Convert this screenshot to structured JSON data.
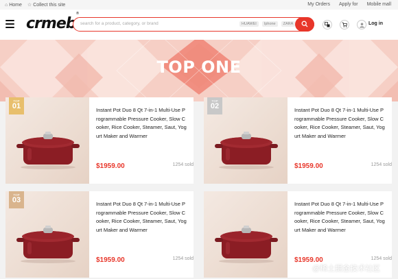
{
  "topbar": {
    "home_label": "Home",
    "collect_label": "Collect this site",
    "my_orders": "My Orders",
    "apply_for": "Apply for",
    "mobile_mall": "Mobile mall"
  },
  "header": {
    "logo_text": "crmeb",
    "logo_mark": "®",
    "search_placeholder": "search for a product, category, or brand",
    "search_tags": [
      "HUAWEI",
      "Iphone",
      "ZARA"
    ],
    "login_label": "Log in"
  },
  "banner": {
    "title": "TOP ONE"
  },
  "colors": {
    "accent": "#e8362a",
    "gold": "#e8bf6c",
    "silver": "#c8c8c8",
    "bronze": "#d9b48d"
  },
  "icons": [
    "home-icon",
    "star-icon",
    "menu-icon",
    "search-icon",
    "language-icon",
    "cart-icon",
    "avatar-icon"
  ],
  "products": [
    {
      "rank_label": "TOP",
      "rank": "01",
      "name": "Instant Pot Duo 8 Qt 7-in-1 Multi-Use Programmable Pressure Cooker, Slow Cooker, Rice Cooker, Steamer, Saut, Yogurt Maker and Warmer",
      "price": "$1959.00",
      "sold": "1254 sold"
    },
    {
      "rank_label": "TOP",
      "rank": "02",
      "name": "Instant Pot Duo 8 Qt 7-in-1 Multi-Use Programmable Pressure Cooker, Slow Cooker, Rice Cooker, Steamer, Saut, Yogurt Maker and Warmer",
      "price": "$1959.00",
      "sold": "1254 sold"
    },
    {
      "rank_label": "TOP",
      "rank": "03",
      "name": "Instant Pot Duo 8 Qt 7-in-1 Multi-Use Programmable Pressure Cooker, Slow Cooker, Rice Cooker, Steamer, Saut, Yogurt Maker and Warmer",
      "price": "$1959.00",
      "sold": "1254 sold"
    },
    {
      "name": "Instant Pot Duo 8 Qt 7-in-1 Multi-Use Programmable Pressure Cooker, Slow Cooker, Rice Cooker, Steamer, Saut, Yogurt Maker and Warmer",
      "price": "$1959.00",
      "sold": "1254 sold"
    }
  ],
  "watermark": "@稀土掘金技术社区"
}
